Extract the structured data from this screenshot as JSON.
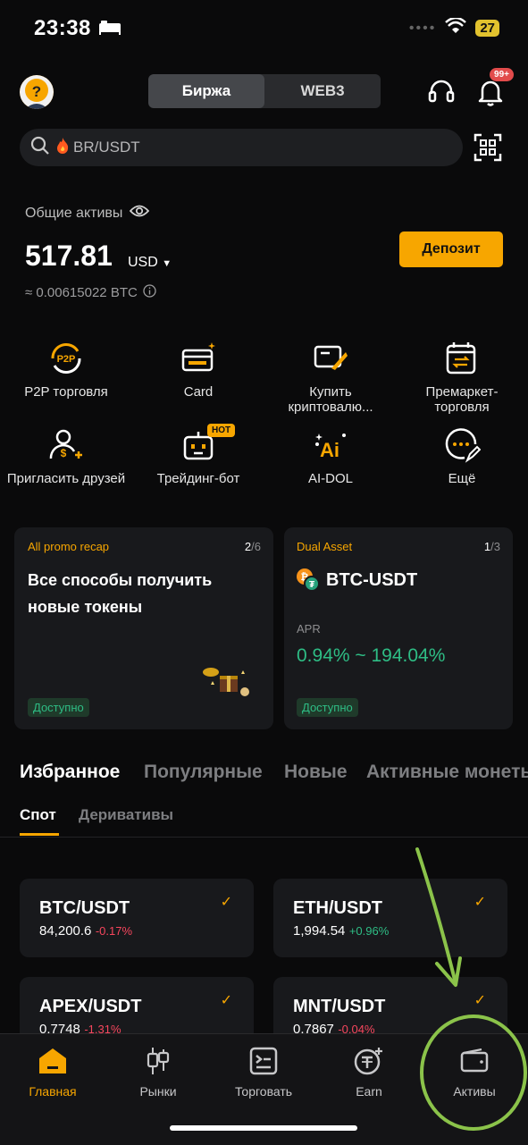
{
  "status_bar": {
    "time": "23:38",
    "battery": "27"
  },
  "header": {
    "segments": [
      "Биржа",
      "WEB3"
    ],
    "notification_badge": "99+"
  },
  "search": {
    "placeholder": "BR/USDT"
  },
  "assets": {
    "label": "Общие активы",
    "value": "517.81",
    "currency": "USD",
    "btc_equivalent": "≈ 0.00615022 BTC",
    "deposit_label": "Депозит"
  },
  "quick_actions": [
    {
      "label": "P2P торговля",
      "icon": "p2p-icon"
    },
    {
      "label": "Card",
      "icon": "card-icon"
    },
    {
      "label": "Купить криптовалю...",
      "icon": "buy-crypto-icon"
    },
    {
      "label": "Премаркет-торговля",
      "icon": "premarket-icon"
    },
    {
      "label": "Пригласить друзей",
      "icon": "invite-icon"
    },
    {
      "label": "Трейдинг-бот",
      "icon": "trading-bot-icon",
      "badge": "HOT"
    },
    {
      "label": "AI-DOL",
      "icon": "ai-icon"
    },
    {
      "label": "Ещё",
      "icon": "more-icon"
    }
  ],
  "promo_cards": [
    {
      "tag": "All promo recap",
      "page_current": "2",
      "page_total": "/6",
      "title_line1": "Все способы получить",
      "title_line2": "новые токены",
      "status": "Доступно"
    },
    {
      "tag": "Dual Asset",
      "page_current": "1",
      "page_total": "/3",
      "pair": "BTC-USDT",
      "apr_label": "APR",
      "apr_value": "0.94% ~ 194.04%",
      "status": "Доступно"
    }
  ],
  "market_tabs": [
    "Избранное",
    "Популярные",
    "Новые",
    "Активные монеты"
  ],
  "sub_tabs": [
    "Спот",
    "Деривативы"
  ],
  "pairs": [
    {
      "name": "BTC/USDT",
      "price": "84,200.6",
      "change": "-0.17%",
      "direction": "down"
    },
    {
      "name": "ETH/USDT",
      "price": "1,994.54",
      "change": "+0.96%",
      "direction": "up"
    },
    {
      "name": "APEX/USDT",
      "price": "0.7748",
      "change": "-1.31%",
      "direction": "down"
    },
    {
      "name": "MNT/USDT",
      "price": "0.7867",
      "change": "-0.04%",
      "direction": "down"
    }
  ],
  "bottom_nav": [
    {
      "label": "Главная",
      "icon": "home-icon",
      "active": true
    },
    {
      "label": "Рынки",
      "icon": "markets-icon"
    },
    {
      "label": "Торговать",
      "icon": "trade-icon"
    },
    {
      "label": "Earn",
      "icon": "earn-icon"
    },
    {
      "label": "Активы",
      "icon": "wallet-icon"
    }
  ],
  "colors": {
    "accent": "#f7a600",
    "positive": "#2ebd85",
    "negative": "#f6465d",
    "annotation": "#8bc34a"
  }
}
